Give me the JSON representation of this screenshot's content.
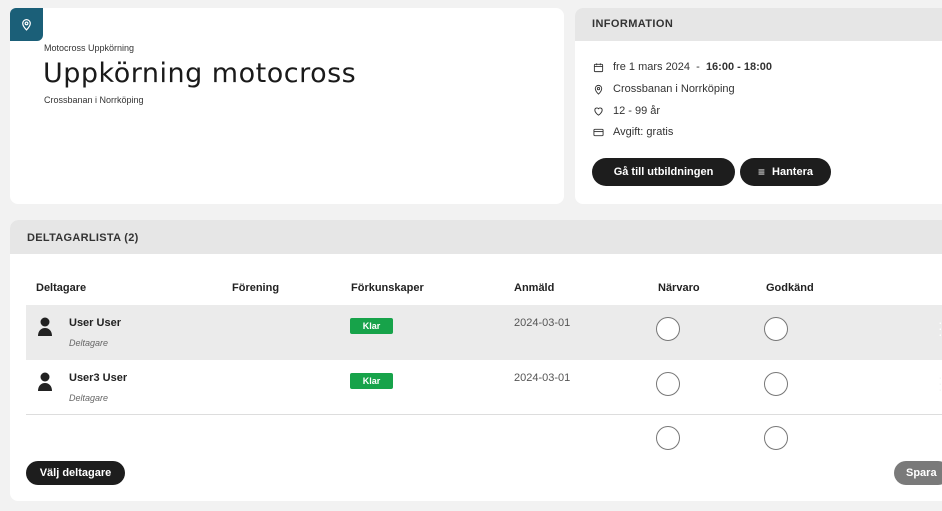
{
  "event": {
    "subtitle": "Motocross Uppkörning",
    "title": "Uppkörning motocross",
    "location": "Crossbanan i Norrköping",
    "badge_icon": "location-pin-icon"
  },
  "information": {
    "header": "INFORMATION",
    "date_text": "fre 1 mars 2024  -  ",
    "time_text": "16:00 - 18:00",
    "location": "Crossbanan i Norrköping",
    "age": "12 - 99 år",
    "fee": "Avgift: gratis",
    "btn_education": "Gå till utbildningen",
    "btn_manage": "Hantera"
  },
  "participants": {
    "header": "DELTAGARLISTA (2)",
    "columns": [
      "Deltagare",
      "Förening",
      "Förkunskaper",
      "Anmäld",
      "Närvaro",
      "Godkänd"
    ],
    "rows": [
      {
        "name": "User User",
        "role": "Deltagare",
        "club": "",
        "prereq": "Klar",
        "registered": "2024-03-01"
      },
      {
        "name": "User3 User",
        "role": "Deltagare",
        "club": "",
        "prereq": "Klar",
        "registered": "2024-03-01"
      }
    ],
    "btn_select": "Välj deltagare",
    "btn_save": "Spara"
  },
  "colors": {
    "badge_blue": "#1b5f78",
    "done_green": "#17a34a",
    "button_dark": "#1d1d1d"
  }
}
